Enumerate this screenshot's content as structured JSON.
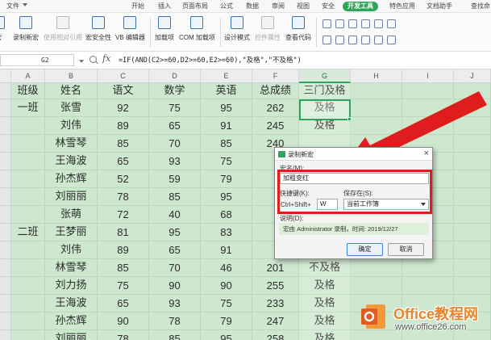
{
  "tabs": [
    "文件",
    "开始",
    "插入",
    "页面布局",
    "公式",
    "数据",
    "审阅",
    "视图",
    "安全",
    "开发工具",
    "特色应用",
    "文档助手",
    "查找命"
  ],
  "active_tab": "开发工具",
  "toolbar": {
    "record_macro_partial": "宏",
    "record_new_macro": "录制新宏",
    "use_relative_ref": "使用相对引用",
    "macro_security": "宏安全性",
    "vb_editor": "VB 编辑器",
    "addins": "加载项",
    "com_addins": "COM 加载项",
    "design_mode": "设计模式",
    "control_props": "控件属性",
    "view_code": "查看代码"
  },
  "formula_bar": {
    "cell_ref": "G2",
    "fx": "fx",
    "formula": "=IF(AND(C2>=60,D2>=60,E2>=60),\"及格\",\"不及格\")"
  },
  "columns": [
    "A",
    "B",
    "C",
    "D",
    "E",
    "F",
    "G",
    "H",
    "I",
    "J"
  ],
  "selected_column": "G",
  "headers": [
    "班级",
    "姓名",
    "语文",
    "数学",
    "英语",
    "总成绩",
    "三门及格"
  ],
  "rows": [
    {
      "class": "一班",
      "name": "张雪",
      "chinese": "92",
      "math": "75",
      "english": "95",
      "total": "262",
      "pass": "及格"
    },
    {
      "class": "",
      "name": "刘伟",
      "chinese": "89",
      "math": "65",
      "english": "91",
      "total": "245",
      "pass": "及格"
    },
    {
      "class": "",
      "name": "林雪琴",
      "chinese": "85",
      "math": "70",
      "english": "85",
      "total": "240",
      "pass": ""
    },
    {
      "class": "",
      "name": "王海波",
      "chinese": "65",
      "math": "93",
      "english": "75",
      "total": "",
      "pass": ""
    },
    {
      "class": "",
      "name": "孙杰辉",
      "chinese": "52",
      "math": "59",
      "english": "79",
      "total": "",
      "pass": ""
    },
    {
      "class": "",
      "name": "刘丽丽",
      "chinese": "78",
      "math": "85",
      "english": "95",
      "total": "",
      "pass": ""
    },
    {
      "class": "",
      "name": "张萌",
      "chinese": "72",
      "math": "40",
      "english": "68",
      "total": "",
      "pass": ""
    },
    {
      "class": "二班",
      "name": "王梦丽",
      "chinese": "81",
      "math": "95",
      "english": "83",
      "total": "",
      "pass": ""
    },
    {
      "class": "",
      "name": "刘伟",
      "chinese": "89",
      "math": "65",
      "english": "91",
      "total": "",
      "pass": ""
    },
    {
      "class": "",
      "name": "林雪琴",
      "chinese": "85",
      "math": "70",
      "english": "46",
      "total": "201",
      "pass": "不及格"
    },
    {
      "class": "",
      "name": "刘力扬",
      "chinese": "75",
      "math": "90",
      "english": "90",
      "total": "255",
      "pass": "及格"
    },
    {
      "class": "",
      "name": "王海波",
      "chinese": "65",
      "math": "93",
      "english": "75",
      "total": "233",
      "pass": "及格"
    },
    {
      "class": "",
      "name": "孙杰辉",
      "chinese": "90",
      "math": "78",
      "english": "79",
      "total": "247",
      "pass": "及格"
    },
    {
      "class": "",
      "name": "刘丽丽",
      "chinese": "78",
      "math": "85",
      "english": "95",
      "total": "258",
      "pass": "及格"
    }
  ],
  "dialog": {
    "title": "录制新宏",
    "close": "×",
    "macro_name_label": "宏名(M):",
    "macro_name_value": "加粗变红",
    "shortcut_label": "快捷键(K):",
    "shortcut_prefix": "Ctrl+Shift+",
    "shortcut_key": "W",
    "store_in_label": "保存在(S):",
    "store_in_value": "当前工作簿",
    "description_label": "说明(D):",
    "description_value": "宏由 Administrator 录制，时间: 2019/12/27",
    "ok_label": "确定",
    "cancel_label": "取消"
  },
  "watermark": {
    "title": "Office教程网",
    "url": "www.office26.com"
  },
  "colors": {
    "accent": "#2fa55b",
    "sheet_bg": "#cde8cf",
    "highlight_red": "#e01d1d",
    "watermark_orange": "#e8852b"
  }
}
